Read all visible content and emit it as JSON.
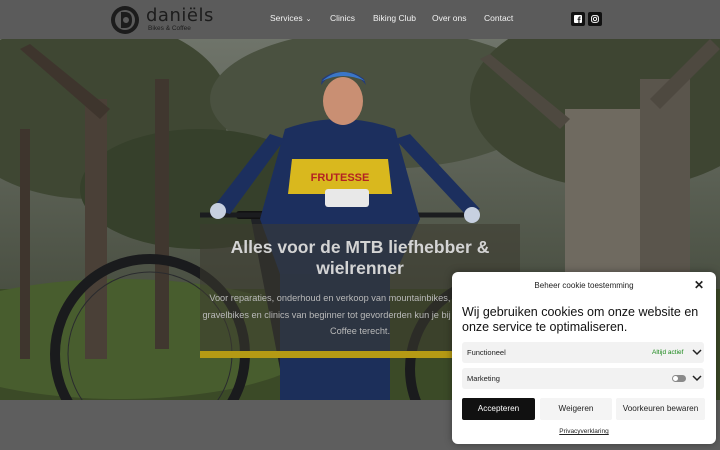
{
  "header": {
    "logo_name": "daniëls",
    "logo_sub": "Bikes & Coffee",
    "nav": [
      "Services",
      "Clinics",
      "Biking Club",
      "Over ons",
      "Contact"
    ],
    "social_icons": [
      "facebook-icon",
      "instagram-icon"
    ]
  },
  "hero": {
    "title": "Alles voor de MTB liefhebber & wielrenner",
    "subtitle": "Voor reparaties, onderhoud en verkoop van mountainbikes, racefietsen en gravelbikes en clinics van beginner tot gevorderden kun je bij Daniëls Bikes & Coffee terecht.",
    "jersey_text": "FRUTESSE"
  },
  "cookie": {
    "heading": "Beheer cookie toestemming",
    "message": "Wij gebruiken cookies om onze website en onze service te optimaliseren.",
    "categories": [
      {
        "label": "Functioneel",
        "status": "Altijd actief"
      },
      {
        "label": "Marketing"
      }
    ],
    "accept": "Accepteren",
    "refuse": "Weigeren",
    "preferences": "Voorkeuren bewaren",
    "privacy": "Privacyverklaring"
  },
  "colors": {
    "header_bg": "#5b5b5b",
    "accent_yellow": "#b59a14",
    "status_green": "#1e8a1e"
  }
}
